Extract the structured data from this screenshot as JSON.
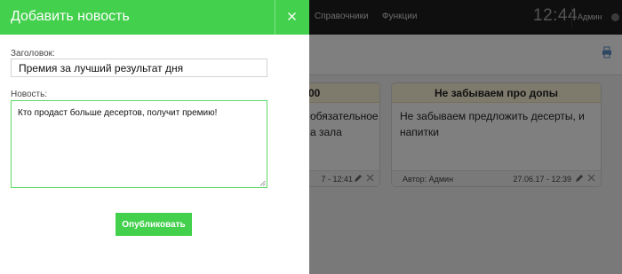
{
  "app": {
    "nav": [
      "Справочники",
      "Функции"
    ],
    "clock": "12:44",
    "user": "Админ"
  },
  "icons": {
    "print": "printer-icon",
    "close": "close-icon",
    "edit": "pencil-icon",
    "delete": "close-icon",
    "user": "user-icon",
    "resize": "resize-grip-icon"
  },
  "news_cards": [
    {
      "title": "00",
      "body": "обязательное\nа зала",
      "author": "",
      "date": "7 - 12:41"
    },
    {
      "title": "Не забываем про допы",
      "body": "Не забываем предложить десерты, и напитки",
      "author": "Автор: Админ",
      "date": "27.06.17 - 12:39"
    }
  ],
  "modal": {
    "title": "Добавить новость",
    "title_label": "Заголовок:",
    "title_value": "Премия за лучший результат дня",
    "news_label": "Новость:",
    "news_value": "Кто продаст больше десертов, получит премию!",
    "publish_label": "Опубликовать"
  },
  "colors": {
    "accent": "#43d04c",
    "topbar": "#1f1f1f",
    "card_header": "#fcf6d8",
    "overlay": "rgba(0,0,0,0.5)"
  }
}
